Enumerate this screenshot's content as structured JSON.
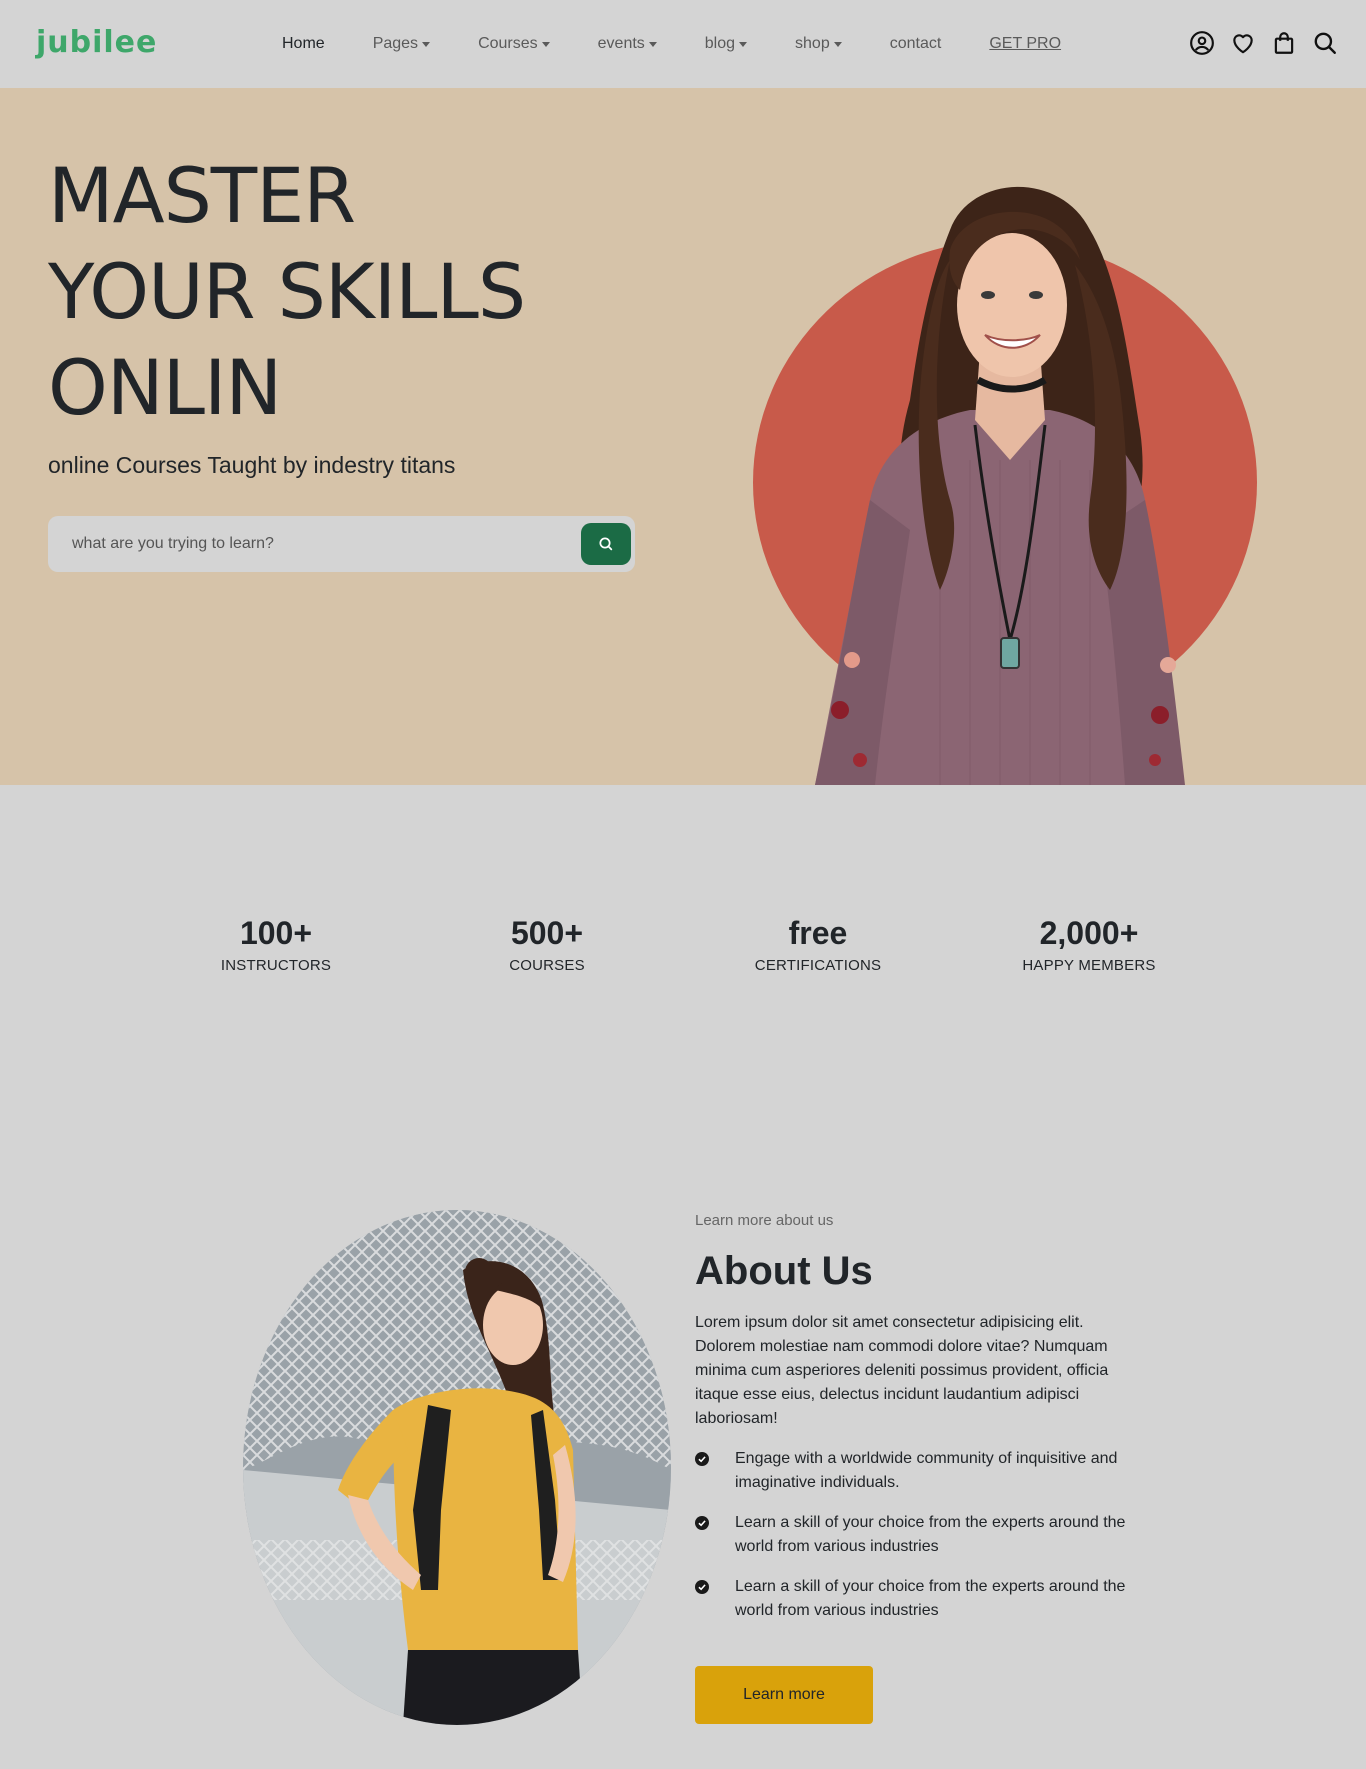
{
  "brand": {
    "name": "jubilee",
    "color": "#3ea76a"
  },
  "nav": {
    "links": [
      {
        "label": "Home",
        "dropdown": false,
        "active": true
      },
      {
        "label": "Pages",
        "dropdown": true
      },
      {
        "label": "Courses",
        "dropdown": true
      },
      {
        "label": "events",
        "dropdown": true
      },
      {
        "label": "blog",
        "dropdown": true
      },
      {
        "label": "shop",
        "dropdown": true
      },
      {
        "label": "contact",
        "dropdown": false
      }
    ],
    "pro_label": "GET PRO",
    "icons": [
      "user-circle-icon",
      "heart-icon",
      "shopping-bag-icon",
      "search-icon"
    ]
  },
  "hero": {
    "title_lines": [
      "MASTER",
      "YOUR SKILLS",
      "ONLIN"
    ],
    "subtitle": "online Courses Taught by indestry titans",
    "search_placeholder": "what are you trying to learn?",
    "accent_color": "#c85a4a",
    "bg_color": "#d6c3a9",
    "button_color": "#1b6b45"
  },
  "stats": [
    {
      "value": "100+",
      "label": "INSTRUCTORS"
    },
    {
      "value": "500+",
      "label": "COURSES"
    },
    {
      "value": "free",
      "label": "CERTIFICATIONS"
    },
    {
      "value": "2,000+",
      "label": "HAPPY MEMBERS"
    }
  ],
  "about": {
    "kicker": "Learn more about us",
    "title": "About Us",
    "paragraph": "Lorem ipsum dolor sit amet consectetur adipisicing elit. Dolorem molestiae nam commodi dolore vitae? Numquam minima cum asperiores deleniti possimus provident, officia itaque esse eius, delectus incidunt laudantium adipisci laboriosam!",
    "features": [
      "Engage with a worldwide community of inquisitive and imaginative individuals.",
      "Learn a skill of your choice from the experts around the world from various industries",
      "Learn a skill of your choice from the experts around the world from various industries"
    ],
    "button_label": "Learn more",
    "button_color": "#d9a20b"
  }
}
